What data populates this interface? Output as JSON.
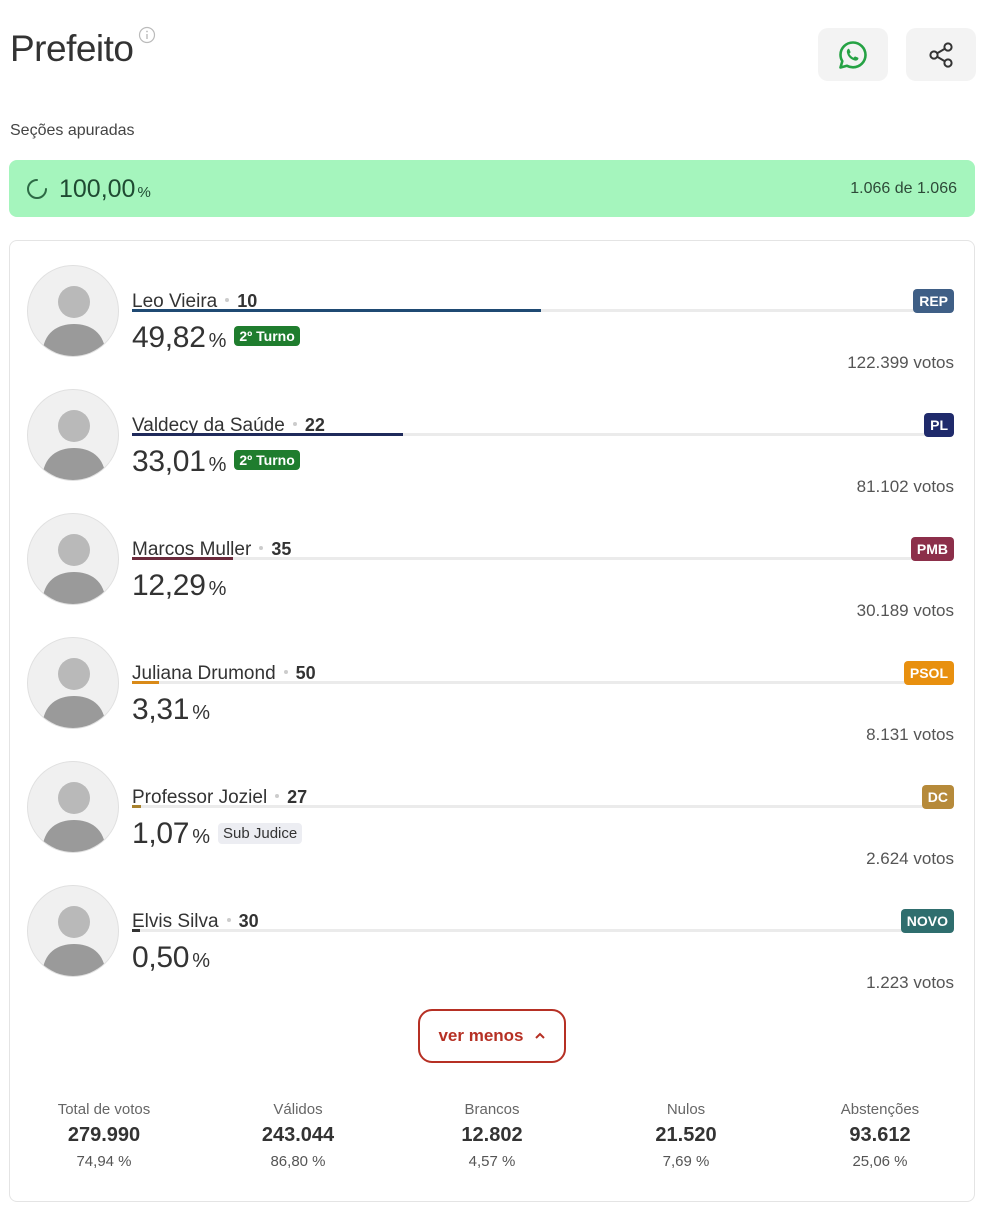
{
  "header": {
    "title": "Prefeito",
    "whatsapp_icon": "whatsapp-icon",
    "share_icon": "share-icon"
  },
  "sections": {
    "label": "Seções apuradas",
    "percent": "100,00",
    "percent_unit": "%",
    "count": "1.066 de 1.066",
    "bar_color": "#a5f5bd"
  },
  "candidates": [
    {
      "name": "Leo Vieira",
      "number": "10",
      "percent": "49,82",
      "unit": "%",
      "tag": "2º Turno",
      "party": "REP",
      "party_color": "#3f5f86",
      "votes": "122.399 votos",
      "share": 0.4982,
      "bar_color": "#1f4a73"
    },
    {
      "name": "Valdecy da Saúde",
      "number": "22",
      "percent": "33,01",
      "unit": "%",
      "tag": "2º Turno",
      "party": "PL",
      "party_color": "#1f2a6b",
      "votes": "81.102 votos",
      "share": 0.3301,
      "bar_color": "#1f2a5b"
    },
    {
      "name": "Marcos Muller",
      "number": "35",
      "percent": "12,29",
      "unit": "%",
      "tag": "",
      "party": "PMB",
      "party_color": "#8c2f4a",
      "votes": "30.189 votos",
      "share": 0.1229,
      "bar_color": "#6b2a3c"
    },
    {
      "name": "Juliana Drumond",
      "number": "50",
      "percent": "3,31",
      "unit": "%",
      "tag": "",
      "party": "PSOL",
      "party_color": "#e8900f",
      "votes": "8.131 votos",
      "share": 0.0331,
      "bar_color": "#d98a18"
    },
    {
      "name": "Professor Joziel",
      "number": "27",
      "percent": "1,07",
      "unit": "%",
      "tag": "Sub Judice",
      "party": "DC",
      "party_color": "#b68a3a",
      "votes": "2.624 votos",
      "share": 0.0107,
      "bar_color": "#a8822e"
    },
    {
      "name": "Elvis Silva",
      "number": "30",
      "percent": "0,50",
      "unit": "%",
      "tag": "",
      "party": "NOVO",
      "party_color": "#2f6e6e",
      "votes": "1.223 votos",
      "share": 0.005,
      "bar_color": "#333333"
    }
  ],
  "toggle": {
    "label": "ver menos",
    "icon": "chevron-up-icon"
  },
  "stats": [
    {
      "label": "Total de votos",
      "value": "279.990",
      "percent": "74,94 %"
    },
    {
      "label": "Válidos",
      "value": "243.044",
      "percent": "86,80 %"
    },
    {
      "label": "Brancos",
      "value": "12.802",
      "percent": "4,57 %"
    },
    {
      "label": "Nulos",
      "value": "21.520",
      "percent": "7,69 %"
    },
    {
      "label": "Abstenções",
      "value": "93.612",
      "percent": "25,06 %"
    }
  ]
}
